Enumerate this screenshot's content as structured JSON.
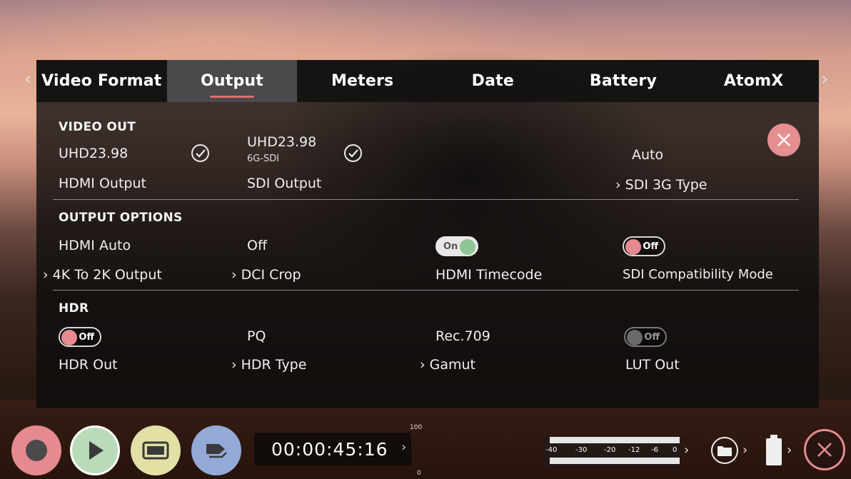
{
  "tabs": [
    "Video Format",
    "Output",
    "Meters",
    "Date",
    "Battery",
    "AtomX"
  ],
  "active_tab": "Output",
  "nav": {
    "prev": "‹",
    "next": "›"
  },
  "video_out": {
    "title": "VIDEO OUT",
    "hdmi_value": "UHD23.98",
    "hdmi_label": "HDMI Output",
    "sdi_value": "UHD23.98",
    "sdi_sub": "6G-SDI",
    "sdi_label": "SDI Output",
    "sdi3g_value": "Auto",
    "sdi3g_label": "› SDI 3G Type"
  },
  "output_options": {
    "title": "OUTPUT OPTIONS",
    "k4_value": "HDMI Auto",
    "k4_label": "› 4K To 2K Output",
    "dci_value": "Off",
    "dci_label": "› DCI Crop",
    "hdmi_tc_toggle": "On",
    "hdmi_tc_label": "HDMI Timecode",
    "sdi_compat_toggle": "Off",
    "sdi_compat_label": "SDI Compatibility Mode"
  },
  "hdr": {
    "title": "HDR",
    "hdr_out_toggle": "Off",
    "hdr_out_label": "HDR Out",
    "hdr_type_value": "PQ",
    "hdr_type_label": "› HDR Type",
    "gamut_value": "Rec.709",
    "gamut_label": "› Gamut",
    "lut_out_toggle": "Off",
    "lut_out_label": "LUT Out"
  },
  "bottom_bar": {
    "timecode": "00:00:45:16",
    "timecode_chevron": "›",
    "scale_top": "100",
    "scale_bottom": "0",
    "meter_labels": [
      "-40",
      "-30",
      "-20",
      "-12",
      "-6",
      "0"
    ],
    "meter_chevron": "›",
    "folder_chevron": "›",
    "battery_chevron": "›"
  },
  "colors": {
    "record": "#e68a8f",
    "play": "#b9dbb9",
    "monitor": "#e3e0a6",
    "tag": "#93a9d8",
    "close": "#e78f90",
    "toggle_on": "#8ec594",
    "tab_underline": "#e26d6d"
  }
}
